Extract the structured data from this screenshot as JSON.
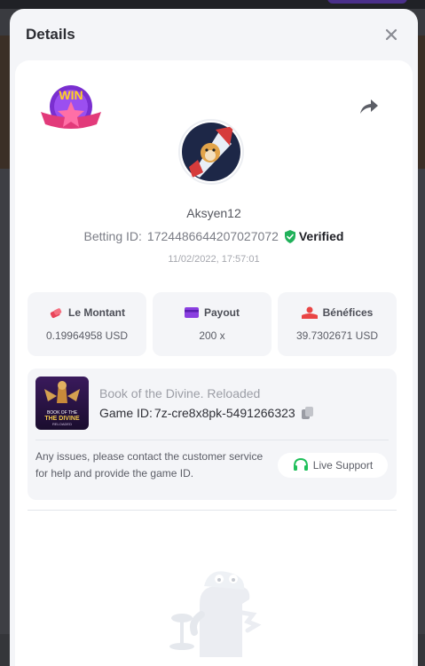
{
  "modal": {
    "title": "Details"
  },
  "bet": {
    "username": "Aksyen12",
    "betting_id_label": "Betting ID:",
    "betting_id": "1724486644207027072",
    "verified_label": "Verified",
    "timestamp": "11/02/2022, 17:57:01",
    "win_badge_text": "WIN"
  },
  "stats": [
    {
      "label": "Le Montant",
      "value": "0.19964958 USD",
      "icon": "coins-icon",
      "color": "#e9445a"
    },
    {
      "label": "Payout",
      "value": "200 x",
      "icon": "card-icon",
      "color": "#8a3fe0"
    },
    {
      "label": "Bénéfices",
      "value": "39.7302671 USD",
      "icon": "profit-icon",
      "color": "#e94545"
    }
  ],
  "game": {
    "name": "Book of the Divine. Reloaded",
    "id_label": "Game ID:",
    "id_value": "7z-cre8x8pk-5491266323",
    "thumb_text_1": "BOOK OF THE",
    "thumb_text_2": "THE DIVINE",
    "thumb_text_3": "RELOADED"
  },
  "support": {
    "help_text": "Any issues, please contact the customer service for help and provide the game ID.",
    "button_label": "Live Support"
  },
  "colors": {
    "verified_green": "#20b15a",
    "live_support_green": "#1fbf5a",
    "accent_purple": "#6c3bd4"
  }
}
